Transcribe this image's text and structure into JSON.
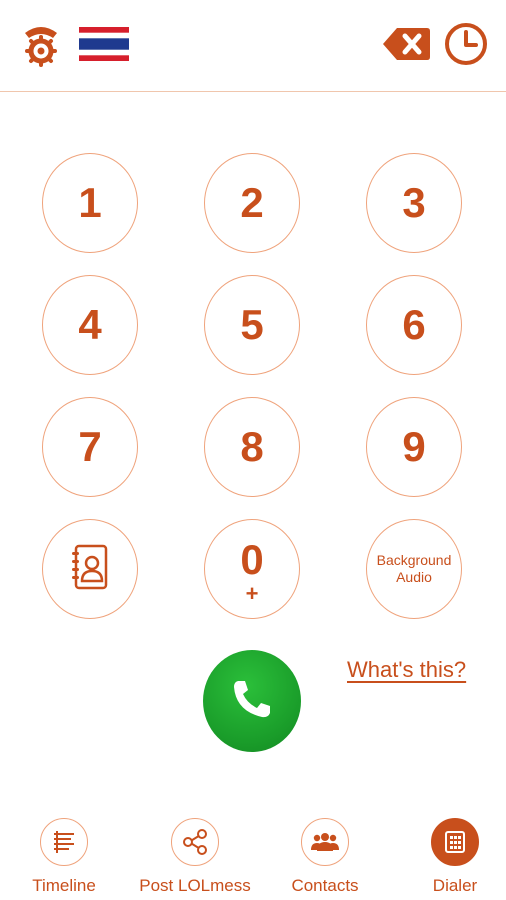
{
  "header": {
    "icons": [
      "settings-phone-icon",
      "thailand-flag-icon",
      "backspace-icon",
      "history-clock-icon"
    ]
  },
  "keypad": {
    "keys": [
      {
        "digit": "1"
      },
      {
        "digit": "2"
      },
      {
        "digit": "3"
      },
      {
        "digit": "4"
      },
      {
        "digit": "5"
      },
      {
        "digit": "6"
      },
      {
        "digit": "7"
      },
      {
        "digit": "8"
      },
      {
        "digit": "9"
      }
    ],
    "contacts_book_icon": "contact-book-icon",
    "zero": {
      "digit": "0",
      "sub": "+"
    },
    "background_audio": {
      "line1": "Background",
      "line2": "Audio"
    }
  },
  "call": {
    "icon": "phone-icon",
    "color": "#1a9d2a"
  },
  "whats_this": "What's this?",
  "tabs": [
    {
      "label": "Timeline",
      "icon": "timeline-icon"
    },
    {
      "label": "Post LOLmess",
      "icon": "share-icon"
    },
    {
      "label": "Contacts",
      "icon": "contacts-group-icon"
    },
    {
      "label": "Dialer",
      "icon": "dialer-icon",
      "active": true
    }
  ],
  "colors": {
    "accent": "#c84f1c",
    "ring": "#efa37c",
    "call_green": "#1a9d2a"
  }
}
